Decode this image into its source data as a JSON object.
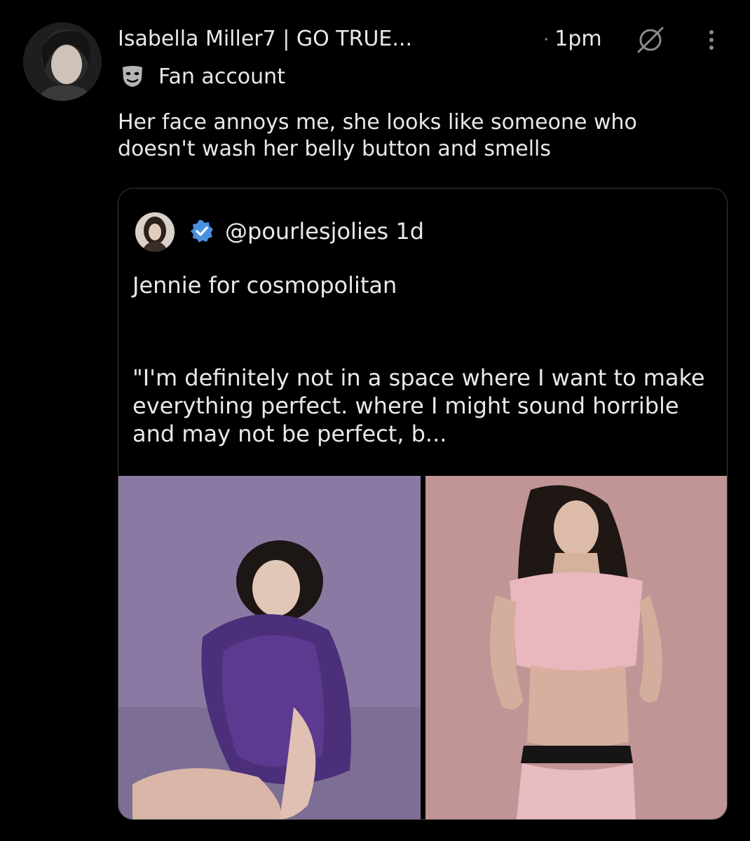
{
  "post": {
    "author_name": "Isabella Miller7 | GO TRUE...",
    "time_separator": "·",
    "time": "1pm",
    "account_label": "Fan account",
    "text": "Her face annoys me, she looks like someone who doesn't wash her belly button and smells"
  },
  "quoted_post": {
    "handle_and_time": "@pourlesjolies 1d",
    "line1": "Jennie for cosmopolitan",
    "line2": "\"I'm definitely not in a space where I want to make everything perfect. where I might sound horrible and may not be perfect, b..."
  },
  "icons": {
    "globe": "globe-strike-icon",
    "more": "more-vertical-icon",
    "mask": "theater-mask-icon",
    "verified": "verified-badge-icon"
  },
  "colors": {
    "background": "#000000",
    "text": "#e7e9ea",
    "border": "#3a3a3a",
    "verified": "#4a90e2"
  }
}
